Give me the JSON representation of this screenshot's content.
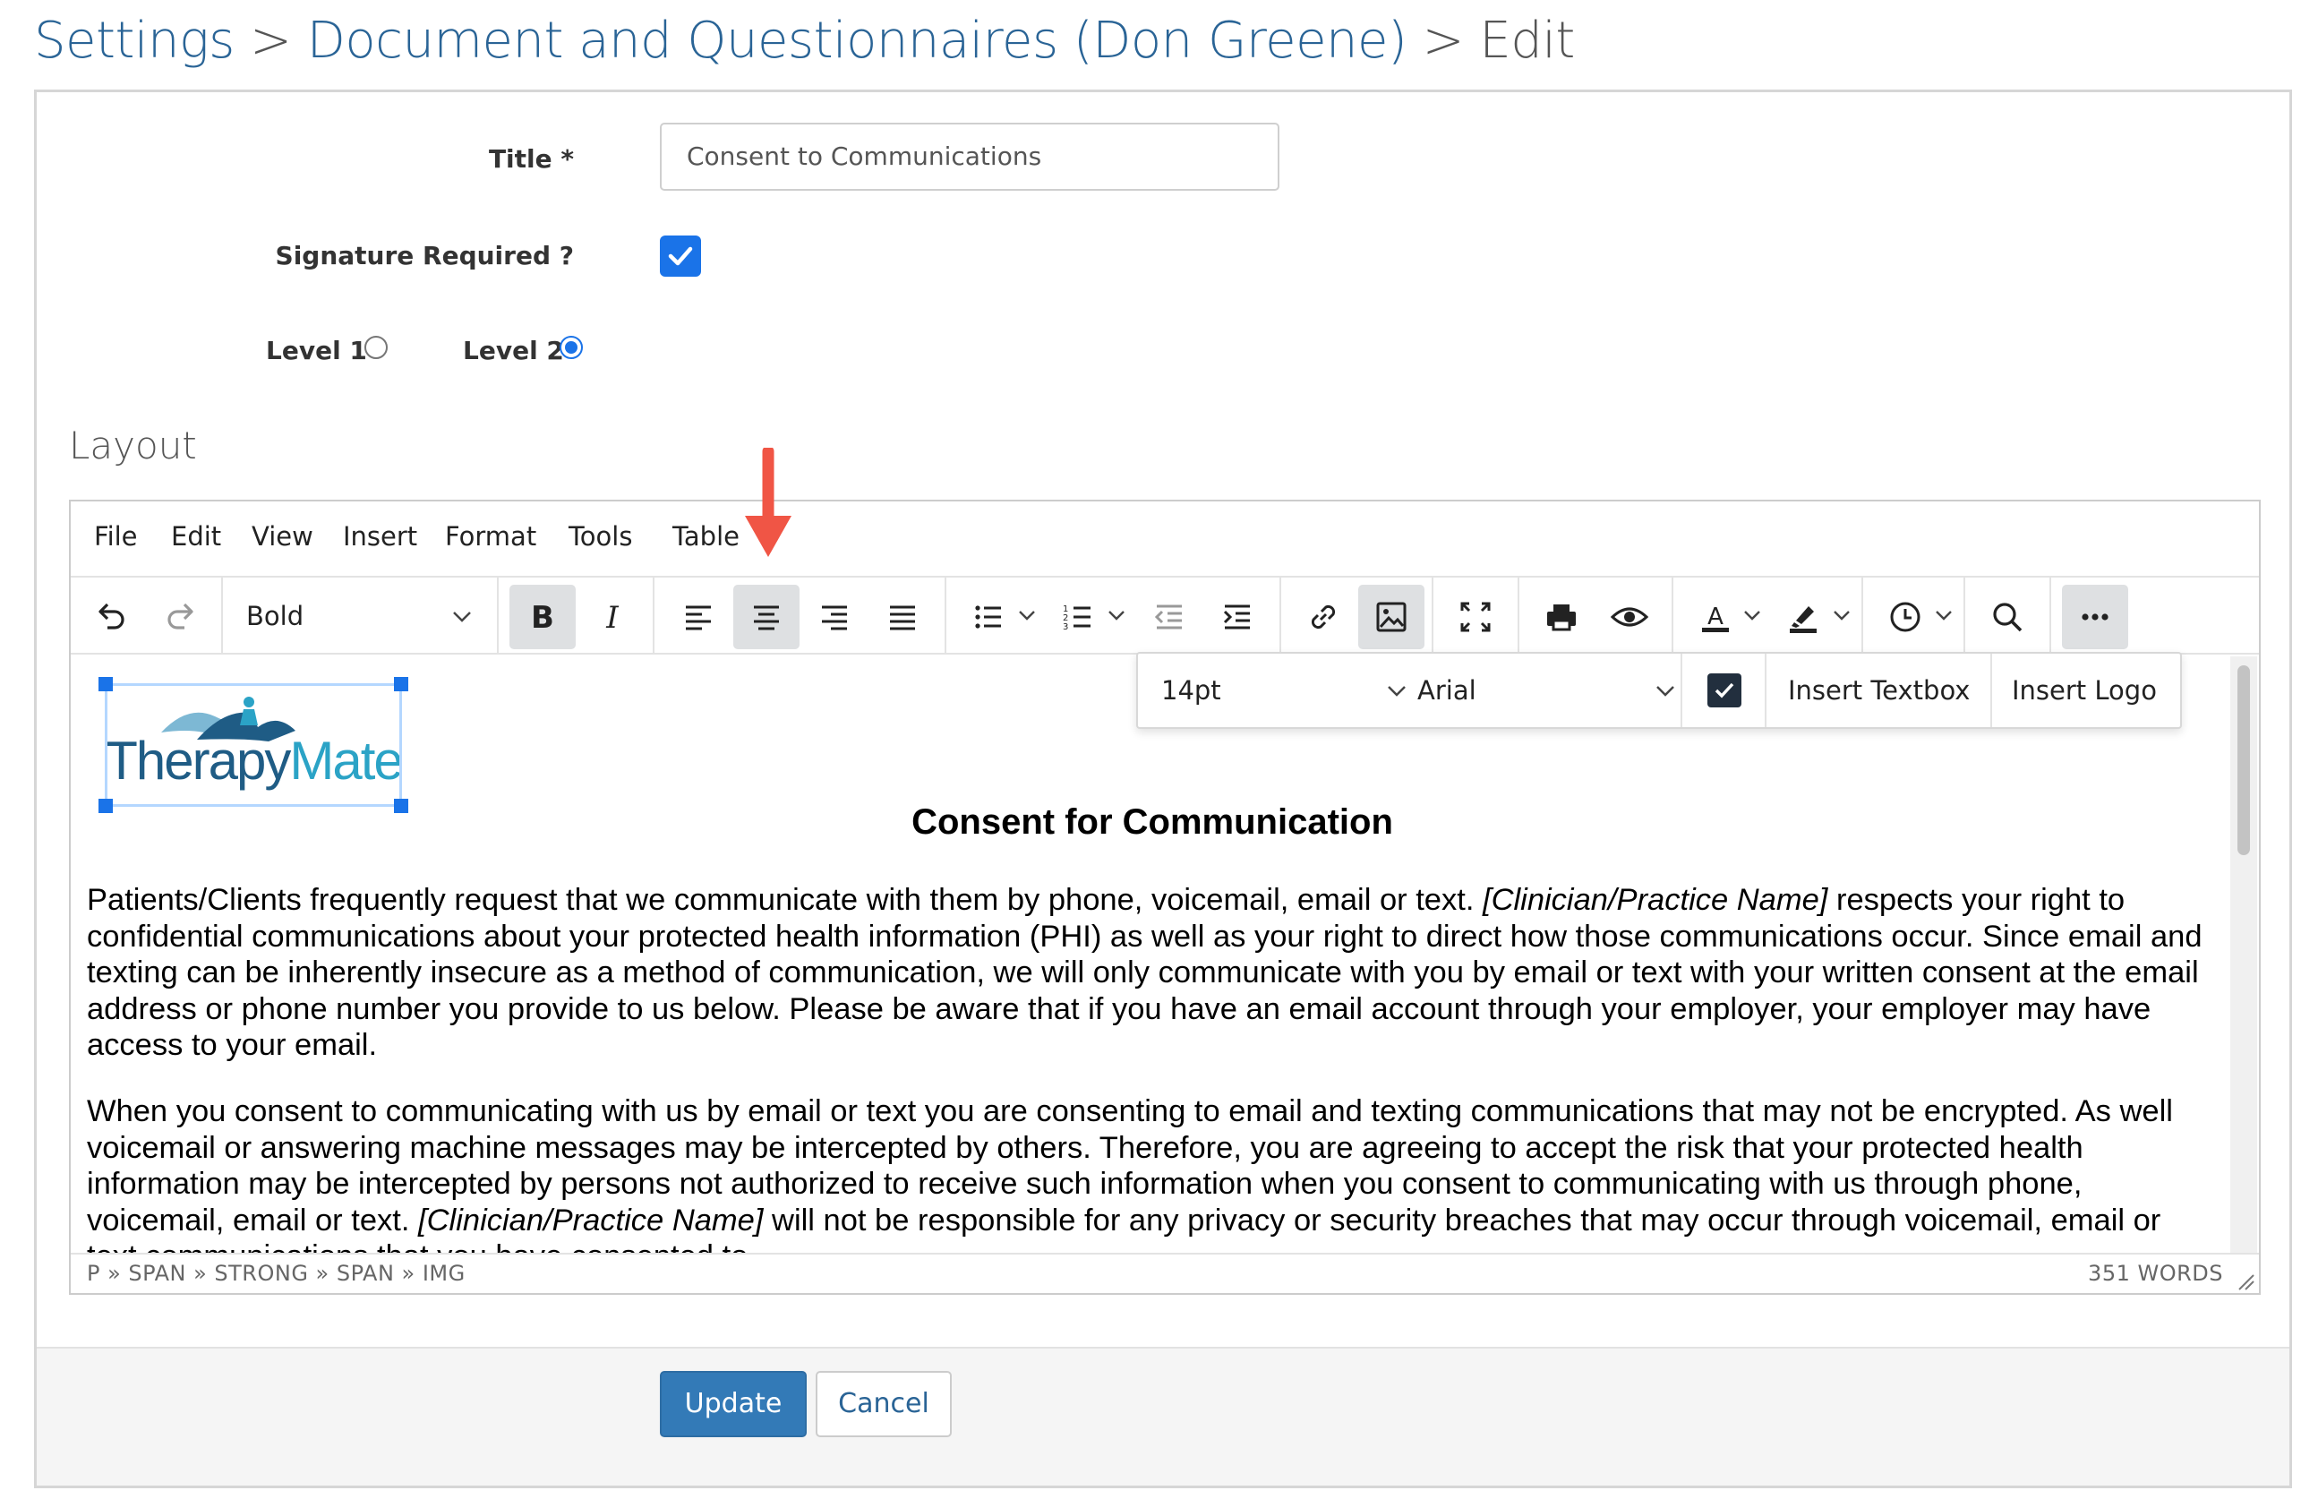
{
  "breadcrumb": {
    "settings": "Settings",
    "sep1": ">",
    "documents": "Document and Questionnaires (Don Greene)",
    "sep2": ">",
    "current": "Edit"
  },
  "form": {
    "title_label": "Title *",
    "title_value": "Consent to Communications",
    "signature_label": "Signature Required ?",
    "signature_checked": true,
    "level1_label": "Level 1",
    "level2_label": "Level 2",
    "selected_level": "Level 2",
    "layout_heading": "Layout"
  },
  "editor": {
    "menu": [
      "File",
      "Edit",
      "View",
      "Insert",
      "Format",
      "Tools",
      "Table"
    ],
    "block_format": "Bold",
    "font_size": "14pt",
    "font_family": "Arial",
    "insert_textbox": "Insert Textbox",
    "insert_logo": "Insert Logo",
    "icons": [
      "undo-icon",
      "redo-icon",
      "bold-icon",
      "italic-icon",
      "align-left-icon",
      "align-center-icon",
      "align-right-icon",
      "align-justify-icon",
      "bullet-list-icon",
      "numbered-list-icon",
      "outdent-icon",
      "indent-icon",
      "link-icon",
      "image-icon",
      "fullscreen-icon",
      "print-icon",
      "preview-icon",
      "text-color-icon",
      "highlight-icon",
      "insert-datetime-icon",
      "search-icon",
      "more-icon"
    ],
    "status_path": "P » SPAN » STRONG » SPAN » IMG",
    "word_count": "351 WORDS",
    "document": {
      "logo_text": "TherapyMate",
      "heading": "Consent for Communication",
      "p1_a": "Patients/Clients frequently request that we communicate with them by phone, voicemail, email or text. ",
      "p1_em": "[Clinician/Practice Name]",
      "p1_b": " respects your right to confidential communications about your protected health information (PHI) as well as your right to direct how those communications occur.   Since email and texting can be inherently insecure as a method of communication, we will only communicate with you by email or text with your written consent at the email address or phone number you provide to us below. Please be aware that if you have an email account through your employer, your employer may have access to your email.",
      "p2_a": "When you consent to communicating with us by email or text you are consenting to email and texting communications that may not be encrypted.  As well voicemail or answering machine messages may be intercepted by others. Therefore, you are agreeing to accept the risk that your protected health information may be intercepted by persons not authorized to receive such information when you consent to communicating with us through phone, voicemail, email or text. ",
      "p2_em": "[Clinician/Practice Name]",
      "p2_b": " will not be responsible for any privacy or security breaches that may occur through voicemail, email or text communications that you have consented to."
    }
  },
  "buttons": {
    "update": "Update",
    "cancel": "Cancel"
  },
  "colors": {
    "link": "#2a6496",
    "primary": "#337ab7",
    "checkbox": "#1a73e8",
    "annotation_arrow": "#f05545",
    "logo_teal": "#2ba3c6",
    "logo_navy": "#1f5c85"
  }
}
